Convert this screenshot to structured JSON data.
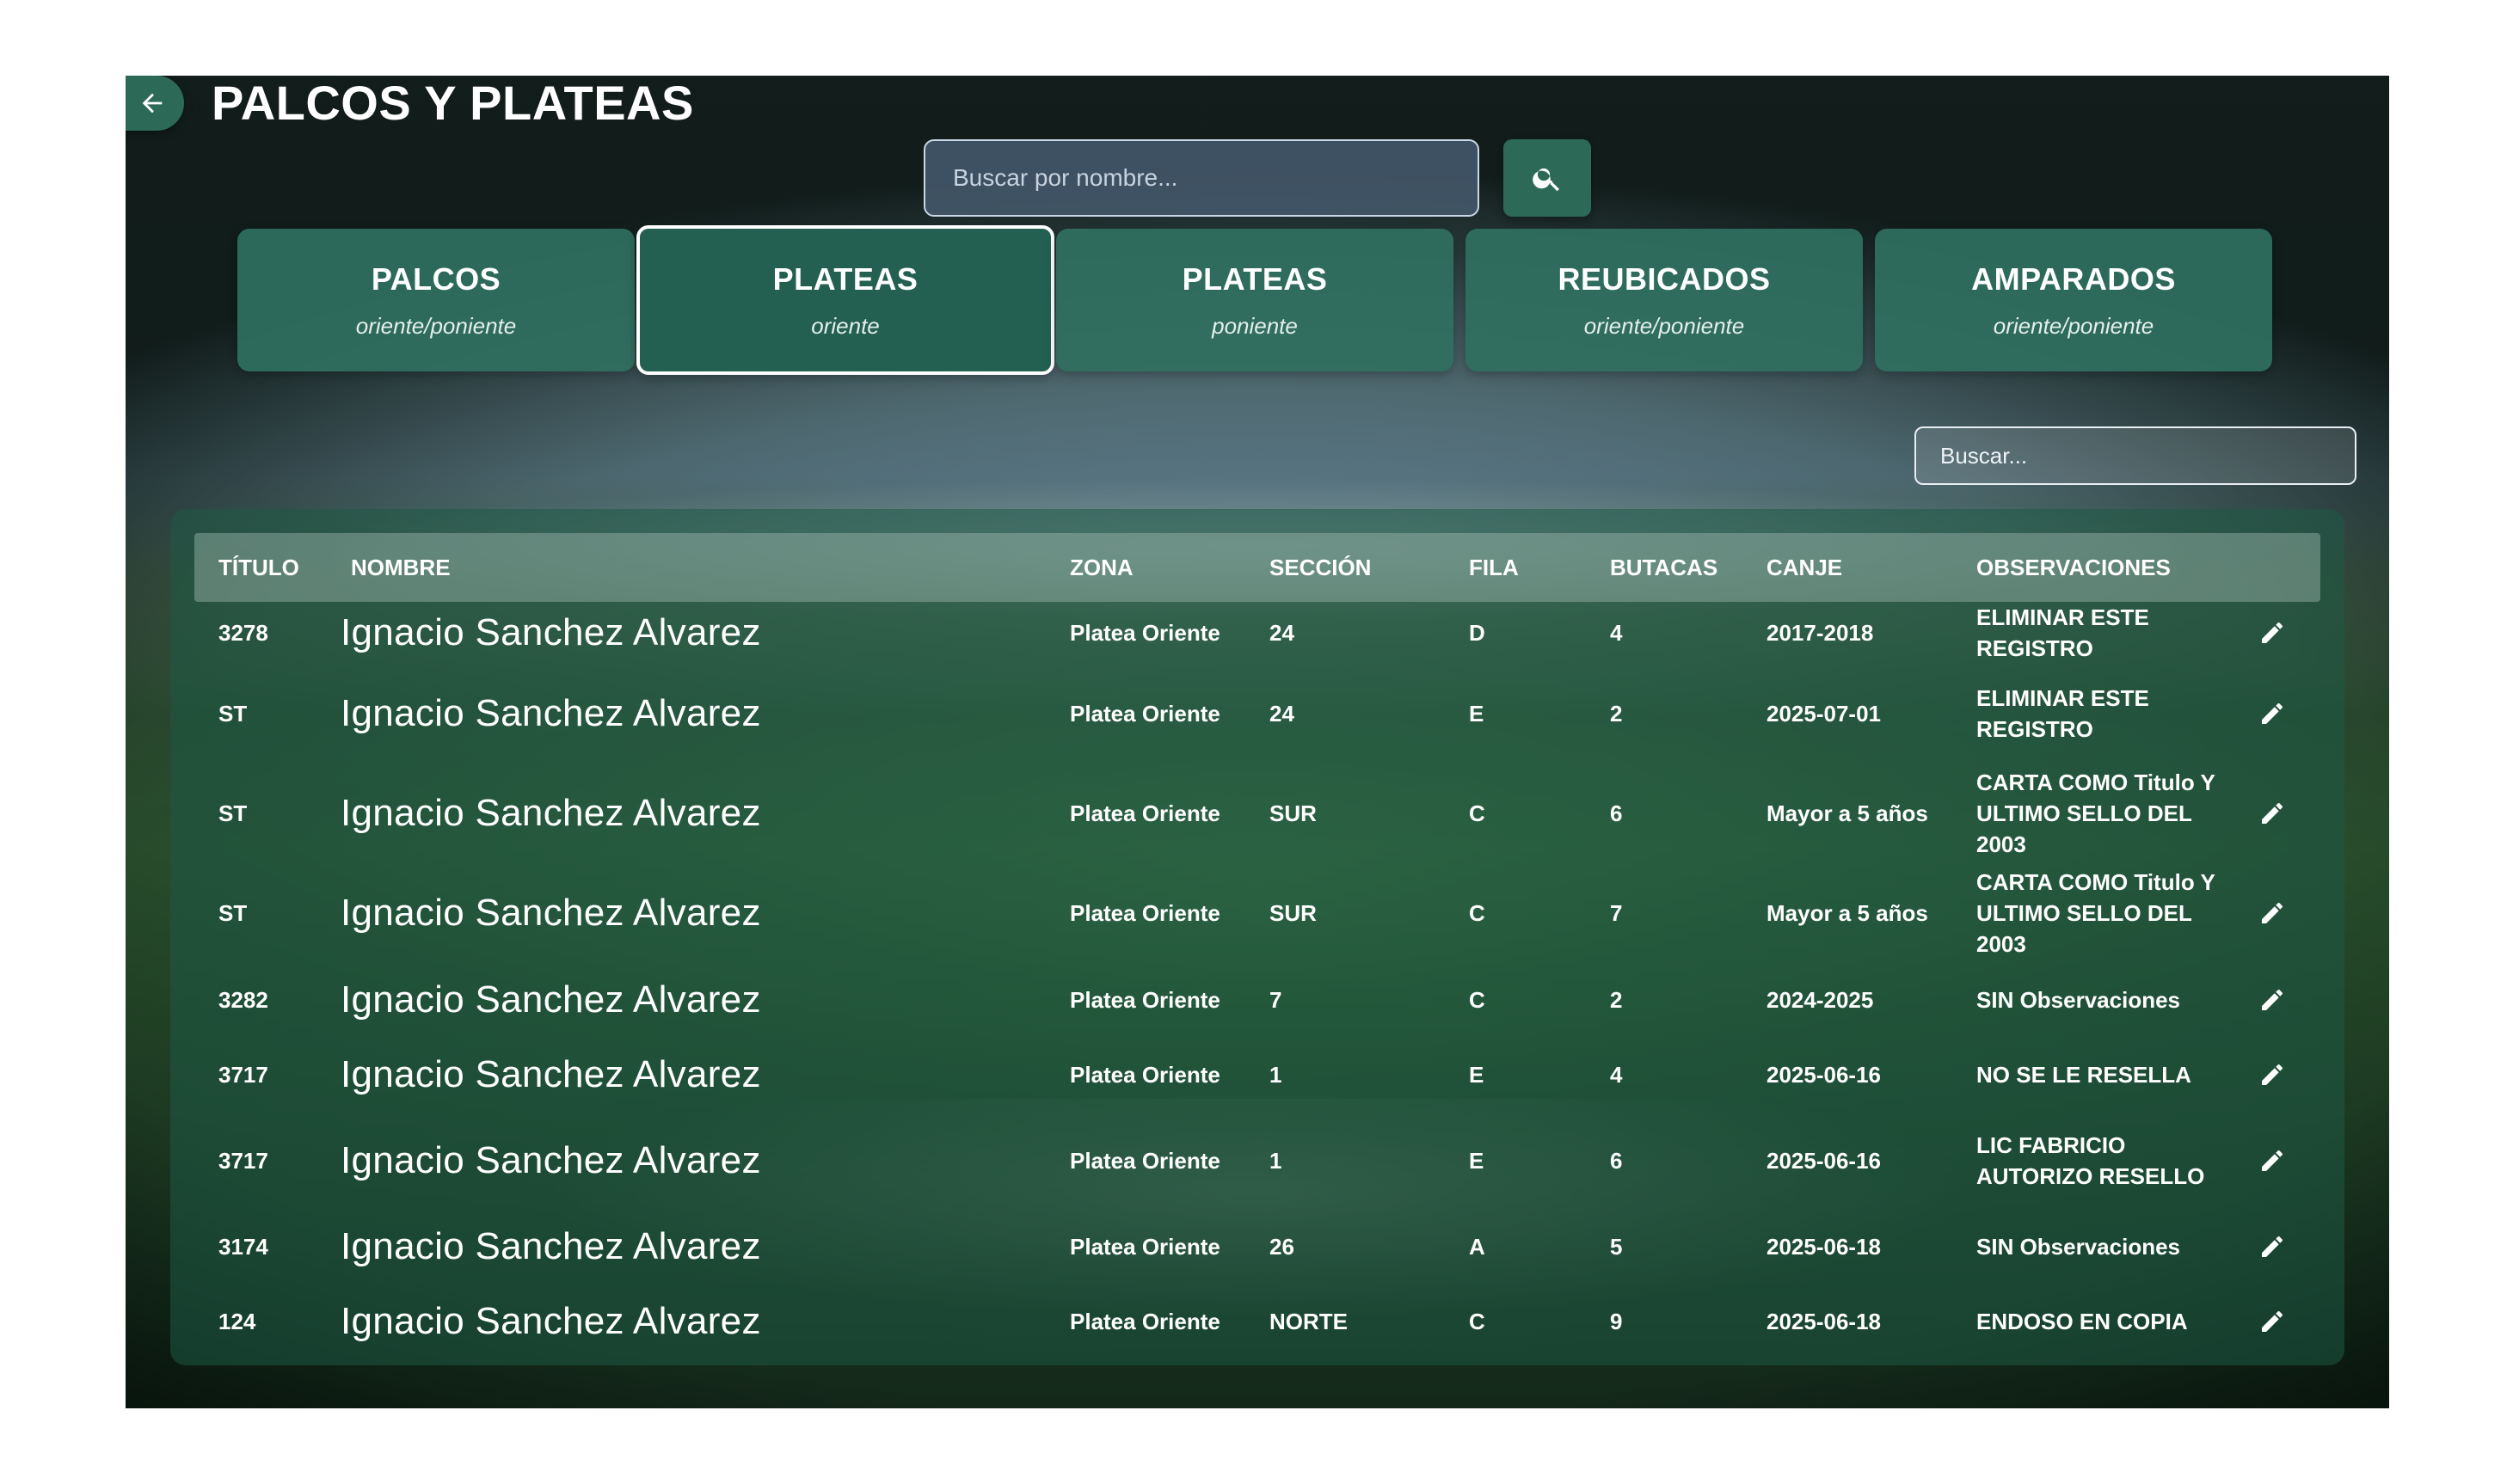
{
  "header": {
    "title": "PALCOS Y PLATEAS"
  },
  "search": {
    "placeholder": "Buscar por nombre..."
  },
  "tabs": [
    {
      "title": "PALCOS",
      "subtitle": "oriente/poniente",
      "active": false
    },
    {
      "title": "PLATEAS",
      "subtitle": "oriente",
      "active": true
    },
    {
      "title": "PLATEAS",
      "subtitle": "poniente",
      "active": false
    },
    {
      "title": "REUBICADOS",
      "subtitle": "oriente/poniente",
      "active": false
    },
    {
      "title": "AMPARADOS",
      "subtitle": "oriente/poniente",
      "active": false
    }
  ],
  "filter": {
    "placeholder": "Buscar..."
  },
  "table": {
    "columns": [
      "TÍTULO",
      "NOMBRE",
      "ZONA",
      "SECCIÓN",
      "FILA",
      "BUTACAS",
      "CANJE",
      "OBSERVACIONES"
    ],
    "rows": [
      {
        "titulo": "3278",
        "nombre": "Ignacio Sanchez Alvarez",
        "zona": "Platea Oriente",
        "seccion": "24",
        "fila": "D",
        "butacas": "4",
        "canje": "2017-2018",
        "observaciones": "ELIMINAR ESTE REGISTRO"
      },
      {
        "titulo": "ST",
        "nombre": "Ignacio Sanchez Alvarez",
        "zona": "Platea Oriente",
        "seccion": "24",
        "fila": "E",
        "butacas": "2",
        "canje": "2025-07-01",
        "observaciones": "ELIMINAR ESTE REGISTRO"
      },
      {
        "titulo": "ST",
        "nombre": "Ignacio Sanchez Alvarez",
        "zona": "Platea Oriente",
        "seccion": "SUR",
        "fila": "C",
        "butacas": "6",
        "canje": "Mayor a 5 años",
        "observaciones": "CARTA COMO Titulo Y ULTIMO SELLO DEL 2003"
      },
      {
        "titulo": "ST",
        "nombre": "Ignacio Sanchez Alvarez",
        "zona": "Platea Oriente",
        "seccion": "SUR",
        "fila": "C",
        "butacas": "7",
        "canje": "Mayor a 5 años",
        "observaciones": "CARTA COMO Titulo Y ULTIMO SELLO DEL 2003"
      },
      {
        "titulo": "3282",
        "nombre": "Ignacio Sanchez Alvarez",
        "zona": "Platea Oriente",
        "seccion": "7",
        "fila": "C",
        "butacas": "2",
        "canje": "2024-2025",
        "observaciones": "SIN Observaciones"
      },
      {
        "titulo": "3717",
        "nombre": "Ignacio Sanchez Alvarez",
        "zona": "Platea Oriente",
        "seccion": "1",
        "fila": "E",
        "butacas": "4",
        "canje": "2025-06-16",
        "observaciones": "NO SE LE RESELLA"
      },
      {
        "titulo": "3717",
        "nombre": "Ignacio Sanchez Alvarez",
        "zona": "Platea Oriente",
        "seccion": "1",
        "fila": "E",
        "butacas": "6",
        "canje": "2025-06-16",
        "observaciones": "LIC FABRICIO AUTORIZO RESELLO"
      },
      {
        "titulo": "3174",
        "nombre": "Ignacio Sanchez Alvarez",
        "zona": "Platea Oriente",
        "seccion": "26",
        "fila": "A",
        "butacas": "5",
        "canje": "2025-06-18",
        "observaciones": "SIN Observaciones"
      },
      {
        "titulo": "124",
        "nombre": "Ignacio Sanchez Alvarez",
        "zona": "Platea Oriente",
        "seccion": "NORTE",
        "fila": "C",
        "butacas": "9",
        "canje": "2025-06-18",
        "observaciones": "ENDOSO EN COPIA"
      }
    ]
  },
  "icons": {
    "back": "arrow-left-icon",
    "search": "search-icon",
    "edit": "pencil-icon"
  },
  "colors": {
    "primary": "#2c6a57",
    "active_tab": "#236051",
    "text": "#ffffff"
  }
}
